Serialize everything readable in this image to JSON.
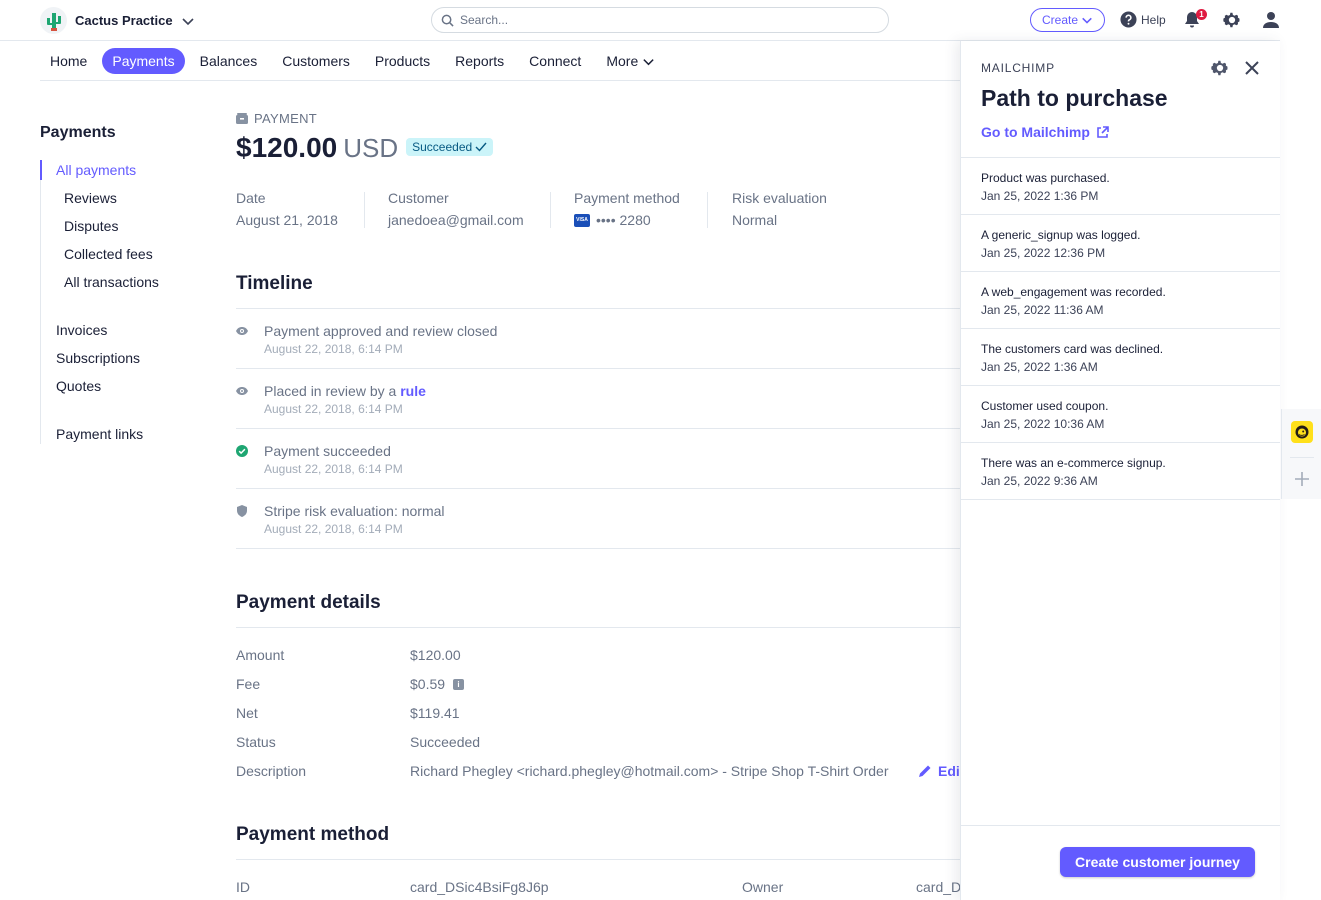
{
  "topbar": {
    "account_name": "Cactus Practice",
    "search_placeholder": "Search...",
    "create_label": "Create",
    "help_label": "Help",
    "notification_count": "1"
  },
  "nav": {
    "items": [
      "Home",
      "Payments",
      "Balances",
      "Customers",
      "Products",
      "Reports",
      "Connect",
      "More"
    ],
    "active": "Payments"
  },
  "sidebar": {
    "title": "Payments",
    "items": [
      "All payments",
      "Reviews",
      "Disputes",
      "Collected fees",
      "All transactions",
      "Invoices",
      "Subscriptions",
      "Quotes",
      "Payment links"
    ],
    "active": "All payments"
  },
  "payment": {
    "label": "PAYMENT",
    "amount": "$120.00",
    "currency": "USD",
    "status": "Succeeded",
    "meta": {
      "date_label": "Date",
      "date_value": "August 21, 2018",
      "customer_label": "Customer",
      "customer_value": "janedoea@gmail.com",
      "method_label": "Payment method",
      "method_card_brand": "VISA",
      "method_value": "•••• 2280",
      "risk_label": "Risk evaluation",
      "risk_value": "Normal"
    }
  },
  "timeline": {
    "title": "Timeline",
    "events": [
      {
        "icon": "eye-icon",
        "title": "Payment approved and review closed",
        "date": "August 22, 2018, 6:14 PM"
      },
      {
        "icon": "eye-icon",
        "title": "Placed in review by a",
        "link": "rule",
        "date": "August 22, 2018, 6:14 PM"
      },
      {
        "icon": "check-circle-icon",
        "title": "Payment succeeded",
        "date": "August 22, 2018, 6:14 PM"
      },
      {
        "icon": "shield-icon",
        "title": "Stripe risk evaluation: normal",
        "date": "August 22, 2018, 6:14 PM"
      }
    ]
  },
  "details": {
    "title": "Payment details",
    "rows": [
      {
        "label": "Amount",
        "value": "$120.00"
      },
      {
        "label": "Fee",
        "value": "$0.59"
      },
      {
        "label": "Net",
        "value": "$119.41"
      },
      {
        "label": "Status",
        "value": "Succeeded"
      },
      {
        "label": "Description",
        "value": "Richard Phegley <richard.phegley@hotmail.com> - Stripe Shop T-Shirt Order"
      }
    ],
    "edit_label": "Edi"
  },
  "method_section": {
    "title": "Payment method",
    "id_label": "ID",
    "id_value": "card_DSic4BsiFg8J6p",
    "owner_label": "Owner",
    "owner_value": "card_D"
  },
  "drawer": {
    "app_name": "MAILCHIMP",
    "title": "Path to purchase",
    "link_label": "Go to Mailchimp",
    "events": [
      {
        "title": "Product was purchased.",
        "date": "Jan 25, 2022 1:36 PM"
      },
      {
        "title": "A generic_signup was logged.",
        "date": "Jan 25, 2022 12:36 PM"
      },
      {
        "title": "A web_engagement was recorded.",
        "date": "Jan 25, 2022 11:36 AM"
      },
      {
        "title": "The customers card was declined.",
        "date": "Jan 25, 2022 1:36 AM"
      },
      {
        "title": "Customer used coupon.",
        "date": "Jan 25, 2022 10:36 AM"
      },
      {
        "title": "There was an e-commerce signup.",
        "date": "Jan 25, 2022 9:36 AM"
      }
    ],
    "button_label": "Create customer journey"
  },
  "colors": {
    "accent": "#635bff",
    "success": "#1ea672",
    "mailchimp_yellow": "#ffe01b"
  }
}
